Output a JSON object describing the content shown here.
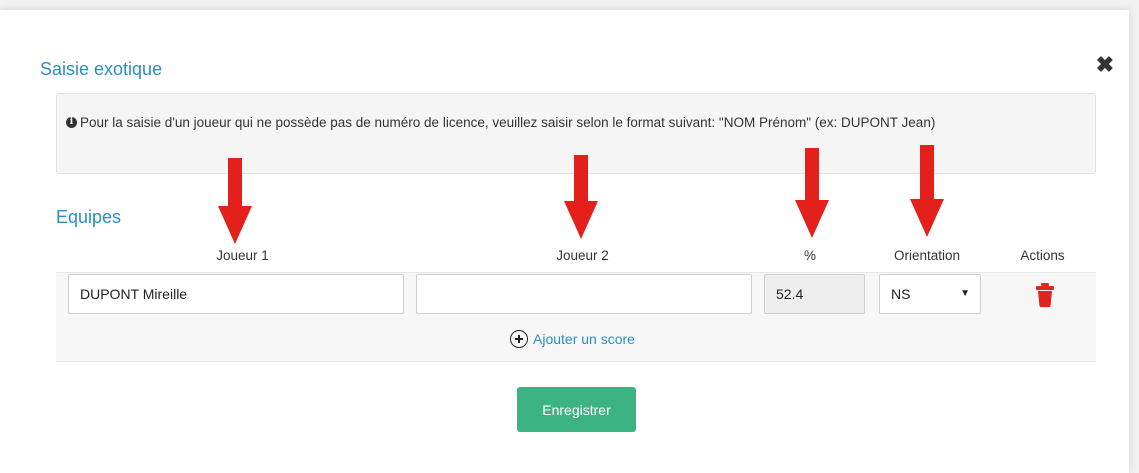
{
  "modal": {
    "title": "Saisie exotique",
    "close_icon": "close-icon"
  },
  "info": {
    "icon": "info-circle-icon",
    "icon_glyph": "i",
    "text": "Pour la saisie d'un joueur qui ne possède pas de numéro de licence, veuillez saisir selon le format suivant: \"NOM Prénom\" (ex: DUPONT Jean)"
  },
  "teams": {
    "section_title": "Equipes",
    "columns": [
      "Joueur 1",
      "Joueur 2",
      "%",
      "Orientation",
      "Actions"
    ],
    "rows": [
      {
        "joueur1": "DUPONT Mireille",
        "joueur2": "",
        "percent": "52.4",
        "orientation": "NS",
        "action_icon": "trash-icon"
      }
    ],
    "add_score_label": "Ajouter un score"
  },
  "save_label": "Enregistrer",
  "colors": {
    "accent": "#2a8fc0",
    "save": "#3cb383",
    "arrow": "#e3201b",
    "trash": "#e0251f"
  }
}
